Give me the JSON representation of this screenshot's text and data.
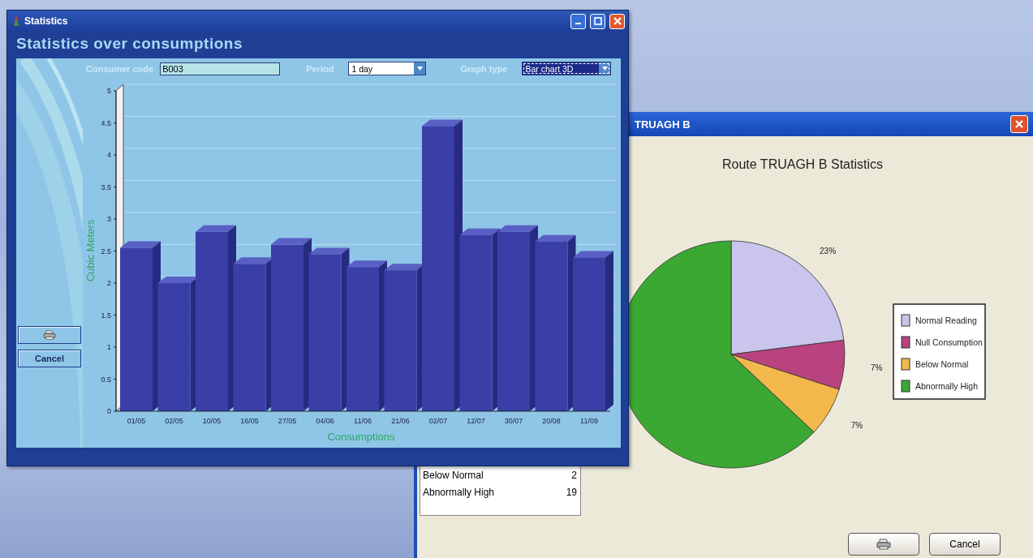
{
  "statistics_window": {
    "title": "Statistics",
    "heading": "Statistics over consumptions",
    "consumer_code": {
      "label": "Consumer code",
      "value": "B003"
    },
    "period": {
      "label": "Period",
      "value": "1 day",
      "focused": false
    },
    "graph_type": {
      "label": "Graph type",
      "value": "Bar chart 3D",
      "focused": true
    },
    "buttons": [
      {
        "kind": "print"
      },
      {
        "kind": "text",
        "label": "Cancel"
      }
    ],
    "chart_data": {
      "type": "bar",
      "xlabel": "Consumptions",
      "ylabel": "Cubic Meters",
      "categories": [
        "01/05",
        "02/05",
        "10/05",
        "16/05",
        "27/05",
        "04/06",
        "11/06",
        "21/06",
        "02/07",
        "12/07",
        "30/07",
        "20/08",
        "11/09"
      ],
      "series": [
        {
          "color": "#3a3fa8",
          "values": [
            2.55,
            2.0,
            2.8,
            2.3,
            2.6,
            2.45,
            2.25,
            2.2,
            4.45,
            2.75,
            2.8,
            2.65,
            2.4
          ]
        }
      ],
      "ylim": [
        0,
        5
      ],
      "yticks": [
        0,
        0.5,
        1,
        1.5,
        2,
        2.5,
        3,
        3.5,
        4,
        4.5,
        5
      ]
    }
  },
  "route_window": {
    "title": "TRUAGH B",
    "chart_data": {
      "type": "pie",
      "title": "Route TRUAGH B Statistics",
      "categories": [
        "Normal Reading",
        "Null Consumption",
        "Below Normal",
        "Abnormally High"
      ],
      "values": [
        23,
        7,
        7,
        63
      ],
      "colors": [
        "#c9c5ec",
        "#b9437f",
        "#f3b84c",
        "#3aa832"
      ],
      "value_labels": [
        "23%",
        "7%",
        "7%",
        null
      ],
      "legend": "right"
    },
    "list_rows": [
      {
        "label": "Below Normal",
        "count": "2"
      },
      {
        "label": "Abnormally High",
        "count": "19"
      }
    ],
    "buttons": [
      {
        "kind": "print"
      },
      {
        "kind": "text",
        "label": "Cancel"
      }
    ]
  }
}
